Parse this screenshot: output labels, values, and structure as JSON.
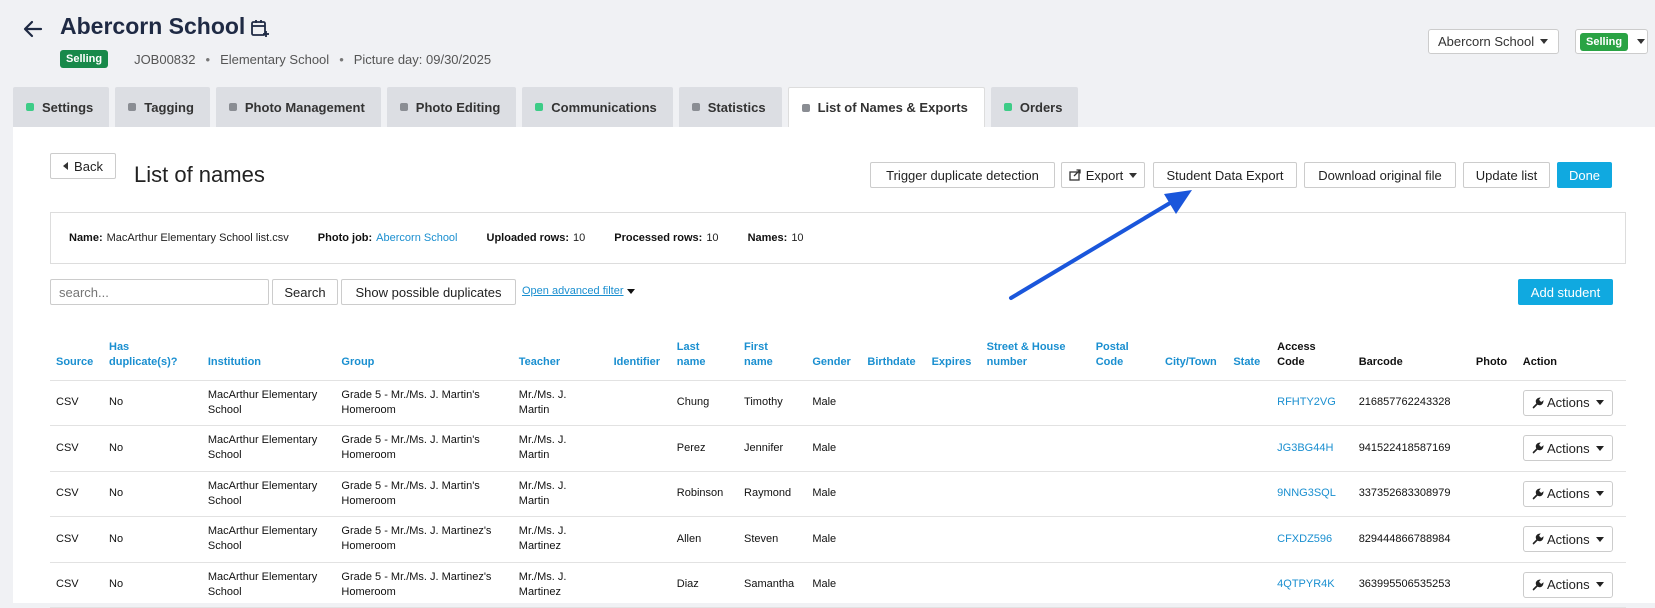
{
  "header": {
    "title": "Abercorn School",
    "status": "Selling",
    "job_id": "JOB00832",
    "school_type": "Elementary School",
    "picture_day": "Picture day: 09/30/2025",
    "school_selector": "Abercorn School",
    "status_selector": "Selling"
  },
  "tabs": [
    {
      "label": "Settings",
      "dot": "green"
    },
    {
      "label": "Tagging",
      "dot": "gray"
    },
    {
      "label": "Photo Management",
      "dot": "gray"
    },
    {
      "label": "Photo Editing",
      "dot": "gray"
    },
    {
      "label": "Communications",
      "dot": "green"
    },
    {
      "label": "Statistics",
      "dot": "gray"
    },
    {
      "label": "List of Names & Exports",
      "dot": "gray",
      "active": true
    },
    {
      "label": "Orders",
      "dot": "green"
    }
  ],
  "toolbar": {
    "back": "Back",
    "title": "List of names",
    "trigger_duplicate": "Trigger duplicate detection",
    "export": "Export",
    "student_data_export": "Student Data Export",
    "download_original": "Download original file",
    "update_list": "Update list",
    "done": "Done"
  },
  "info": {
    "name_label": "Name:",
    "name_value": "MacArthur Elementary School list.csv",
    "photo_job_label": "Photo job:",
    "photo_job_value": "Abercorn School",
    "uploaded_label": "Uploaded rows:",
    "uploaded_value": "10",
    "processed_label": "Processed rows:",
    "processed_value": "10",
    "names_label": "Names:",
    "names_value": "10"
  },
  "search": {
    "placeholder": "search...",
    "search_button": "Search",
    "duplicates_button": "Show possible duplicates",
    "advanced_filter": "Open advanced filter",
    "add_student": "Add student"
  },
  "table": {
    "headers": {
      "source": "Source",
      "has_duplicates_1": "Has",
      "has_duplicates_2": "duplicate(s)?",
      "institution": "Institution",
      "group": "Group",
      "teacher": "Teacher",
      "identifier": "Identifier",
      "last_name_1": "Last",
      "last_name_2": "name",
      "first_name_1": "First",
      "first_name_2": "name",
      "gender": "Gender",
      "birthdate": "Birthdate",
      "expires": "Expires",
      "street_1": "Street & House",
      "street_2": "number",
      "postal_1": "Postal",
      "postal_2": "Code",
      "city": "City/Town",
      "state": "State",
      "access_1": "Access",
      "access_2": "Code",
      "barcode": "Barcode",
      "photo": "Photo",
      "action": "Action"
    },
    "action_label": "Actions",
    "rows": [
      {
        "source": "CSV",
        "dup": "No",
        "inst1": "MacArthur Elementary",
        "inst2": "School",
        "group1": "Grade 5 - Mr./Ms. J. Martin's",
        "group2": "Homeroom",
        "teacher1": "Mr./Ms. J.",
        "teacher2": "Martin",
        "last": "Chung",
        "first": "Timothy",
        "gender": "Male",
        "code": "RFHTY2VG",
        "barcode": "216857762243328"
      },
      {
        "source": "CSV",
        "dup": "No",
        "inst1": "MacArthur Elementary",
        "inst2": "School",
        "group1": "Grade 5 - Mr./Ms. J. Martin's",
        "group2": "Homeroom",
        "teacher1": "Mr./Ms. J.",
        "teacher2": "Martin",
        "last": "Perez",
        "first": "Jennifer",
        "gender": "Male",
        "code": "JG3BG44H",
        "barcode": "941522418587169"
      },
      {
        "source": "CSV",
        "dup": "No",
        "inst1": "MacArthur Elementary",
        "inst2": "School",
        "group1": "Grade 5 - Mr./Ms. J. Martin's",
        "group2": "Homeroom",
        "teacher1": "Mr./Ms. J.",
        "teacher2": "Martin",
        "last": "Robinson",
        "first": "Raymond",
        "gender": "Male",
        "code": "9NNG3SQL",
        "barcode": "337352683308979"
      },
      {
        "source": "CSV",
        "dup": "No",
        "inst1": "MacArthur Elementary",
        "inst2": "School",
        "group1": "Grade 5 - Mr./Ms. J. Martinez's",
        "group2": "Homeroom",
        "teacher1": "Mr./Ms. J.",
        "teacher2": "Martinez",
        "last": "Allen",
        "first": "Steven",
        "gender": "Male",
        "code": "CFXDZ596",
        "barcode": "829444866788984"
      },
      {
        "source": "CSV",
        "dup": "No",
        "inst1": "MacArthur Elementary",
        "inst2": "School",
        "group1": "Grade 5 - Mr./Ms. J. Martinez's",
        "group2": "Homeroom",
        "teacher1": "Mr./Ms. J.",
        "teacher2": "Martinez",
        "last": "Diaz",
        "first": "Samantha",
        "gender": "Male",
        "code": "4QTPYR4K",
        "barcode": "363995506535253"
      }
    ]
  },
  "colors": {
    "accent": "#10a9e0",
    "link": "#1a8fd0",
    "status_green": "#18894a",
    "annotation_arrow": "#1a56db"
  }
}
